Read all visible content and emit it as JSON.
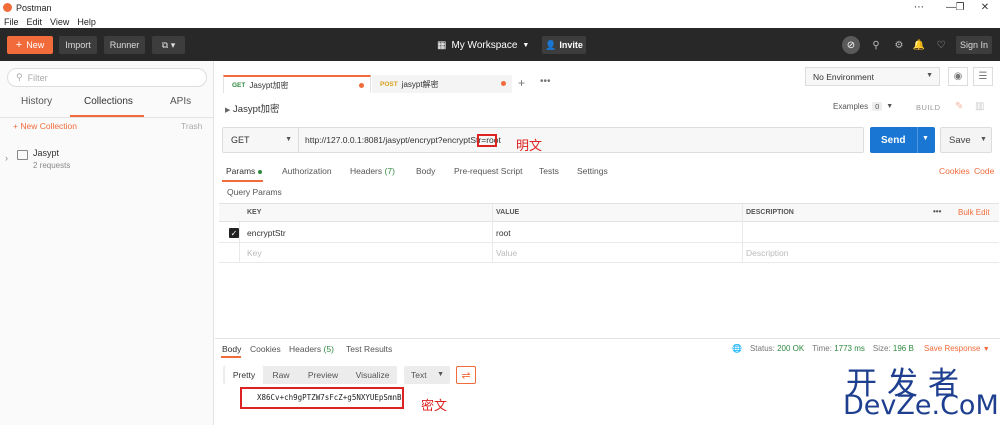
{
  "window": {
    "title": "Postman",
    "min": "—",
    "restore": "❐",
    "close": "✕",
    "more": "⋯"
  },
  "menu": [
    "File",
    "Edit",
    "View",
    "Help"
  ],
  "toolbar": {
    "new_label": "New",
    "import_label": "Import",
    "runner_label": "Runner",
    "workspace_label": "My Workspace",
    "invite_label": "Invite",
    "signin_label": "Sign In"
  },
  "sidebar": {
    "filter_placeholder": "Filter",
    "tabs": [
      "History",
      "Collections",
      "APIs"
    ],
    "new_collection": "+ New Collection",
    "trash": "Trash",
    "collection": {
      "name": "Jasypt",
      "count": "2 requests"
    }
  },
  "tabs": [
    {
      "method": "GET",
      "name": "Jasypt加密"
    },
    {
      "method": "POST",
      "name": "jasypt解密"
    }
  ],
  "environment": {
    "selected": "No Environment"
  },
  "request": {
    "name": "Jasypt加密",
    "examples_label": "Examples",
    "examples_count": "0",
    "build_label": "BUILD",
    "method": "GET",
    "url": "http://127.0.0.1:8081/jasypt/encrypt?encryptStr=root",
    "annotation": "明文",
    "send_label": "Send",
    "save_label": "Save"
  },
  "req_tabs": {
    "params": "Params",
    "authorization": "Authorization",
    "headers": "Headers",
    "headers_count": "(7)",
    "body": "Body",
    "prerequest": "Pre-request Script",
    "tests": "Tests",
    "settings": "Settings",
    "cookies": "Cookies",
    "code": "Code"
  },
  "query_params": {
    "label": "Query Params",
    "columns": {
      "key": "KEY",
      "value": "VALUE",
      "description": "DESCRIPTION",
      "bulk": "Bulk Edit",
      "more": "•••"
    },
    "rows": [
      {
        "key": "encryptStr",
        "value": "root",
        "description": ""
      }
    ],
    "placeholder": {
      "key": "Key",
      "value": "Value",
      "description": "Description"
    }
  },
  "response": {
    "tabs": {
      "body": "Body",
      "cookies": "Cookies",
      "headers": "Headers",
      "headers_count": "(5)",
      "tests": "Test Results"
    },
    "status_label": "Status:",
    "status_value": "200 OK",
    "time_label": "Time:",
    "time_value": "1773 ms",
    "size_label": "Size:",
    "size_value": "196 B",
    "save_response": "Save Response",
    "formats": [
      "Pretty",
      "Raw",
      "Preview",
      "Visualize"
    ],
    "text_select": "Text",
    "body_text": "X86Cv+ch9gPTZW7sFcZ+g5NXYUEpSmnB",
    "annotation": "密文"
  },
  "watermark": {
    "line1": "开发者",
    "line2": "DevZe.CoM"
  },
  "colors": {
    "accent": "#f26b3a",
    "send": "#1976d2",
    "toolbar": "#282828",
    "annotation": "#dd2222"
  }
}
